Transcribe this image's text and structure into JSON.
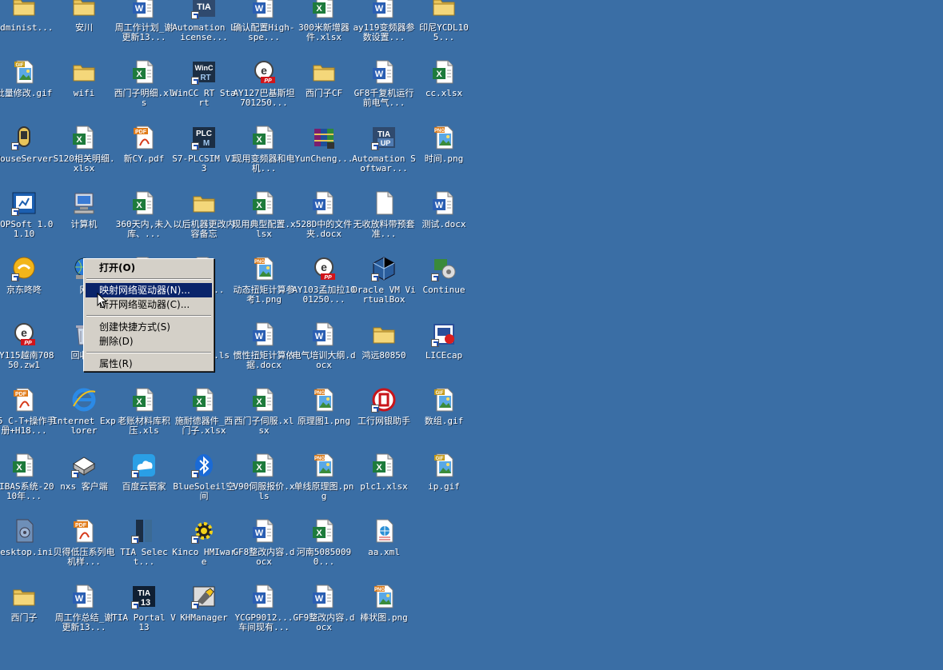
{
  "desktop": {
    "background_color": "#3a6ea5",
    "icons": [
      {
        "label": "Administ...",
        "icon": "folder-icon",
        "name": "desktop-icon-administ"
      },
      {
        "label": "安川",
        "icon": "folder-icon",
        "name": "desktop-icon-anchuan"
      },
      {
        "label": "周工作计划_谢更新13...",
        "icon": "word-doc-icon",
        "name": "desktop-icon-weekly-plan"
      },
      {
        "label": "Automation License...",
        "icon": "tia-license-icon",
        "name": "desktop-icon-automation-license"
      },
      {
        "label": "确认配置High-spe...",
        "icon": "word-doc-icon",
        "name": "desktop-icon-confirm-config"
      },
      {
        "label": "300米新增器件.xlsx",
        "icon": "excel-icon",
        "name": "desktop-icon-300m-xlsx"
      },
      {
        "label": "ay119变频器参数设置...",
        "icon": "word-doc-icon",
        "name": "desktop-icon-ay119"
      },
      {
        "label": "印尼YCDL105...",
        "icon": "folder-icon",
        "name": "desktop-icon-yinni"
      },
      {
        "label": "批量修改.gif",
        "icon": "gif-image-icon",
        "name": "desktop-icon-batch-gif"
      },
      {
        "label": "wifi",
        "icon": "folder-icon",
        "name": "desktop-icon-wifi"
      },
      {
        "label": "西门子明细.xls",
        "icon": "excel-icon",
        "name": "desktop-icon-siemens-detail"
      },
      {
        "label": "WinCC RT Start",
        "icon": "wincc-icon",
        "name": "desktop-icon-wincc"
      },
      {
        "label": "AY127巴基斯坦701250...",
        "icon": "eplan-icon",
        "name": "desktop-icon-ay127"
      },
      {
        "label": "西门子CF",
        "icon": "folder-icon",
        "name": "desktop-icon-siemens-cf"
      },
      {
        "label": "GF8千复机运行前电气...",
        "icon": "word-doc-icon",
        "name": "desktop-icon-gf8"
      },
      {
        "label": "cc.xlsx",
        "icon": "excel-icon",
        "name": "desktop-icon-cc-xlsx"
      },
      {
        "label": "MouseServer",
        "icon": "mouse-server-icon",
        "name": "desktop-icon-mouseserver"
      },
      {
        "label": "S120相关明细.xlsx",
        "icon": "excel-icon",
        "name": "desktop-icon-s120"
      },
      {
        "label": "新CY.pdf",
        "icon": "pdf-icon",
        "name": "desktop-icon-new-cy-pdf"
      },
      {
        "label": "S7-PLCSIM V13",
        "icon": "plcsim-icon",
        "name": "desktop-icon-plcsim"
      },
      {
        "label": "现用变频器和电机...",
        "icon": "excel-icon",
        "name": "desktop-icon-inverters"
      },
      {
        "label": "YunCheng...",
        "icon": "archive-icon",
        "name": "desktop-icon-yuncheng"
      },
      {
        "label": "Automation Softwar...",
        "icon": "tia-update-icon",
        "name": "desktop-icon-automation-software"
      },
      {
        "label": "时间.png",
        "icon": "png-image-icon",
        "name": "desktop-icon-time-png"
      },
      {
        "label": "DOPSoft 1.01.10",
        "icon": "dopsoft-icon",
        "name": "desktop-icon-dopsoft"
      },
      {
        "label": "计算机",
        "icon": "computer-icon",
        "name": "desktop-icon-computer"
      },
      {
        "label": "360天内,未入库、...",
        "icon": "excel-icon",
        "name": "desktop-icon-360days"
      },
      {
        "label": "以后机器更改内容备忘",
        "icon": "folder-icon",
        "name": "desktop-icon-memo-folder"
      },
      {
        "label": "现用典型配置.xlsx",
        "icon": "excel-icon",
        "name": "desktop-icon-typical-config"
      },
      {
        "label": "528D中的文件夹.docx",
        "icon": "word-doc-icon",
        "name": "desktop-icon-528d"
      },
      {
        "label": "无收放料带预套准...",
        "icon": "blank-file-icon",
        "name": "desktop-icon-no-feed"
      },
      {
        "label": "测试.docx",
        "icon": "word-doc-icon",
        "name": "desktop-icon-test-docx"
      },
      {
        "label": "京东咚咚",
        "icon": "jd-dongdong-icon",
        "name": "desktop-icon-jd"
      },
      {
        "label": "网",
        "icon": "network-icon",
        "name": "desktop-icon-network"
      },
      {
        "label": "",
        "icon": "excel-icon",
        "name": "desktop-icon-hidden-1"
      },
      {
        "label": "...按...",
        "icon": "excel-icon",
        "name": "desktop-icon-hidden-2"
      },
      {
        "label": "动态扭矩计算参考1.png",
        "icon": "png-image-icon",
        "name": "desktop-icon-torque-png"
      },
      {
        "label": "AY103孟加拉1001250...",
        "icon": "eplan-icon",
        "name": "desktop-icon-ay103"
      },
      {
        "label": "Oracle VM VirtualBox",
        "icon": "virtualbox-icon",
        "name": "desktop-icon-virtualbox"
      },
      {
        "label": "Continue",
        "icon": "continue-icon",
        "name": "desktop-icon-continue"
      },
      {
        "label": "AY115越南70850.zw1",
        "icon": "eplan-icon",
        "name": "desktop-icon-ay115"
      },
      {
        "label": "回收站",
        "icon": "recycle-bin-icon",
        "name": "desktop-icon-recycle"
      },
      {
        "label": "",
        "icon": "excel-icon",
        "name": "desktop-icon-hidden-3"
      },
      {
        "label": "...按...ls",
        "icon": "excel-icon",
        "name": "desktop-icon-hidden-4"
      },
      {
        "label": "惯性扭矩计算依据.docx",
        "icon": "word-doc-icon",
        "name": "desktop-icon-inertia"
      },
      {
        "label": "电气培训大纲.docx",
        "icon": "word-doc-icon",
        "name": "desktop-icon-training"
      },
      {
        "label": "鸿远80850",
        "icon": "folder-icon",
        "name": "desktop-icon-hongyuan"
      },
      {
        "label": "LICEcap",
        "icon": "licecap-icon",
        "name": "desktop-icon-licecap"
      },
      {
        "label": "25_C-T+操作手册+H18...",
        "icon": "pdf-icon",
        "name": "desktop-icon-manual-pdf"
      },
      {
        "label": "Internet Explorer",
        "icon": "ie-icon",
        "name": "desktop-icon-ie"
      },
      {
        "label": "老账材料库积压.xls",
        "icon": "excel-icon",
        "name": "desktop-icon-old-stock"
      },
      {
        "label": "施耐德器件_西门子.xlsx",
        "icon": "excel-icon",
        "name": "desktop-icon-schneider"
      },
      {
        "label": "西门子伺服.xlsx",
        "icon": "excel-icon",
        "name": "desktop-icon-siemens-servo"
      },
      {
        "label": "原理图1.png",
        "icon": "png-image-icon",
        "name": "desktop-icon-schematic-png"
      },
      {
        "label": "工行网银助手",
        "icon": "icbc-icon",
        "name": "desktop-icon-icbc"
      },
      {
        "label": "数组.gif",
        "icon": "gif-image-icon",
        "name": "desktop-icon-array-gif"
      },
      {
        "label": "SIBAS系统-2010年...",
        "icon": "excel-icon",
        "name": "desktop-icon-sibas"
      },
      {
        "label": "nxs 客户端",
        "icon": "nxs-icon",
        "name": "desktop-icon-nxs"
      },
      {
        "label": "百度云管家",
        "icon": "baidu-cloud-icon",
        "name": "desktop-icon-baidu"
      },
      {
        "label": "BlueSoleil空间",
        "icon": "bluetooth-icon",
        "name": "desktop-icon-bluesoleil"
      },
      {
        "label": "V90伺服报价.xls",
        "icon": "excel-icon",
        "name": "desktop-icon-v90"
      },
      {
        "label": "单线原理图.png",
        "icon": "png-image-icon",
        "name": "desktop-icon-single-line-png"
      },
      {
        "label": "plc1.xlsx",
        "icon": "excel-icon",
        "name": "desktop-icon-plc1"
      },
      {
        "label": "ip.gif",
        "icon": "gif-image-icon",
        "name": "desktop-icon-ip-gif"
      },
      {
        "label": "desktop.ini",
        "icon": "ini-file-icon",
        "name": "desktop-icon-desktop-ini"
      },
      {
        "label": "贝得低压系列电机样...",
        "icon": "pdf-icon",
        "name": "desktop-icon-beide-pdf"
      },
      {
        "label": "TIA Select...",
        "icon": "tia-select-icon",
        "name": "desktop-icon-tia-select"
      },
      {
        "label": "Kinco HMIware",
        "icon": "kinco-icon",
        "name": "desktop-icon-kinco"
      },
      {
        "label": "GF8整改内容.docx",
        "icon": "word-doc-icon",
        "name": "desktop-icon-gf8-rectify"
      },
      {
        "label": "河南50850090...",
        "icon": "excel-icon",
        "name": "desktop-icon-henan"
      },
      {
        "label": "aa.xml",
        "icon": "xml-file-icon",
        "name": "desktop-icon-aa-xml"
      },
      {
        "label": "",
        "icon": "",
        "name": "empty-slot-1"
      },
      {
        "label": "西门子",
        "icon": "folder-icon",
        "name": "desktop-icon-siemens-folder"
      },
      {
        "label": "周工作总结_谢更新13...",
        "icon": "word-doc-icon",
        "name": "desktop-icon-weekly-summary"
      },
      {
        "label": "TIA Portal V13",
        "icon": "tia-portal-icon",
        "name": "desktop-icon-tia-portal"
      },
      {
        "label": "KHManager",
        "icon": "khmanager-icon",
        "name": "desktop-icon-khmanager"
      },
      {
        "label": "YCGP9012...车间现有...",
        "icon": "word-doc-icon",
        "name": "desktop-icon-ycgp9012"
      },
      {
        "label": "GF9整改内容.docx",
        "icon": "word-doc-icon",
        "name": "desktop-icon-gf9-rectify"
      },
      {
        "label": "棒状图.png",
        "icon": "png-image-icon",
        "name": "desktop-icon-bar-png"
      },
      {
        "label": "",
        "icon": "",
        "name": "empty-slot-2"
      }
    ]
  },
  "context_menu": {
    "items": [
      {
        "label": "打开(O)",
        "name": "menu-open",
        "bold": true,
        "highlighted": false
      },
      {
        "sep": true
      },
      {
        "label": "映射网络驱动器(N)...",
        "name": "menu-map-network-drive",
        "bold": false,
        "highlighted": true
      },
      {
        "label": "断开网络驱动器(C)...",
        "name": "menu-disconnect-network-drive",
        "bold": false,
        "highlighted": false
      },
      {
        "sep": true
      },
      {
        "label": "创建快捷方式(S)",
        "name": "menu-create-shortcut",
        "bold": false,
        "highlighted": false
      },
      {
        "label": "删除(D)",
        "name": "menu-delete",
        "bold": false,
        "highlighted": false
      },
      {
        "sep": true
      },
      {
        "label": "属性(R)",
        "name": "menu-properties",
        "bold": false,
        "highlighted": false
      }
    ]
  }
}
